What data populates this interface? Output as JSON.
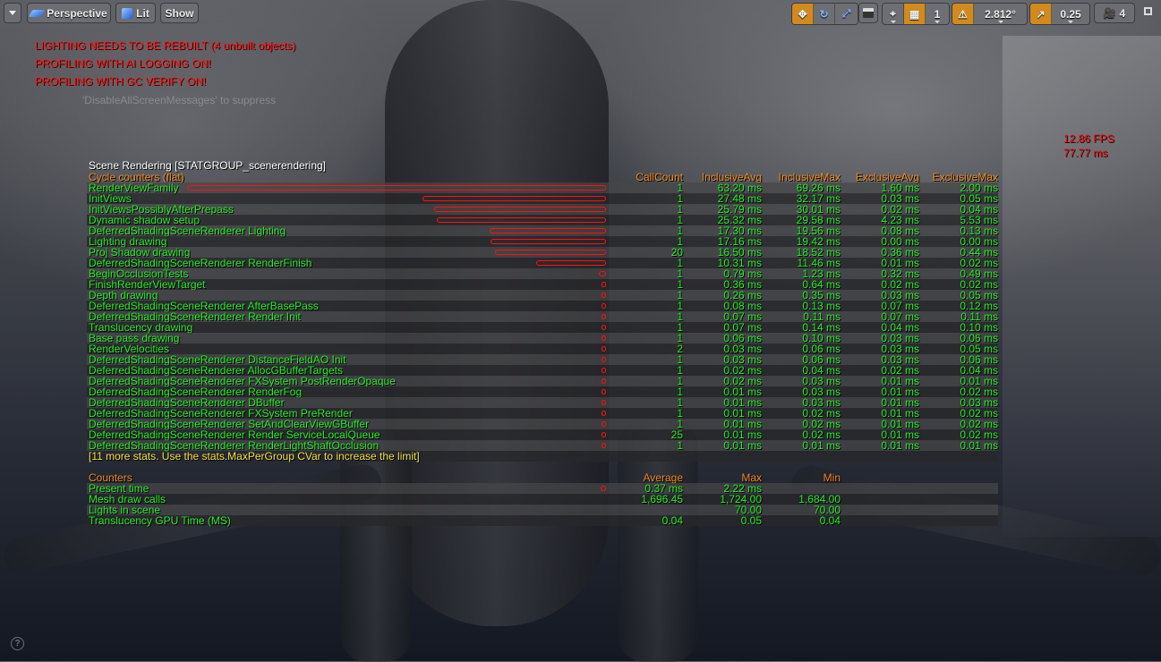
{
  "toolbar": {
    "left": {
      "options_menu_icon": "chevron-down-icon",
      "perspective_label": "Perspective",
      "lit_label": "Lit",
      "show_label": "Show"
    },
    "right": {
      "translate_icon": "move-arrows-icon",
      "rotate_icon": "rotate-icon",
      "scale_icon": "scale-icon",
      "world_local_icon": "cube-icon",
      "surface_snap_icon": "surface-snap-icon",
      "grid_snap_icon": "grid-icon",
      "grid_snap_value": "1",
      "rotation_snap_icon": "angle-icon",
      "rotation_snap_value": "2.812°",
      "scale_snap_icon": "scale-arrow-icon",
      "scale_snap_value": "0.25",
      "camera_speed_icon": "camera-speed-icon",
      "camera_speed_value": "4",
      "maximize_icon": "restore-icon"
    }
  },
  "messages": [
    "LIGHTING NEEDS TO BE REBUILT (4 unbuilt objects)",
    "PROFILING WITH AI LOGGING ON!",
    "PROFILING WITH GC VERIFY ON!"
  ],
  "suppress_hint": "'DisableAllScreenMessages' to suppress",
  "fps": {
    "fps_text": "12.86 FPS",
    "ms_text": "77.77 ms"
  },
  "stats": {
    "group_title": "Scene Rendering [STATGROUP_scenerendering]",
    "cycle_header": {
      "label": "Cycle counters (flat)",
      "call_count": "CallCount",
      "inclusive_avg": "InclusiveAvg",
      "inclusive_max": "InclusiveMax",
      "exclusive_avg": "ExclusiveAvg",
      "exclusive_max": "ExclusiveMax"
    },
    "cycle_rows": [
      {
        "name": "RenderViewFamily",
        "count": "1",
        "iavg": "63.20 ms",
        "imax": "69.26 ms",
        "eavg": "1.60 ms",
        "emax": "2.00 ms",
        "bar": 63.2
      },
      {
        "name": "InitViews",
        "count": "1",
        "iavg": "27.48 ms",
        "imax": "32.17 ms",
        "eavg": "0.03 ms",
        "emax": "0.05 ms",
        "bar": 27.48
      },
      {
        "name": "InitViewsPossiblyAfterPrepass",
        "count": "1",
        "iavg": "25.79 ms",
        "imax": "30.01 ms",
        "eavg": "0.02 ms",
        "emax": "0.04 ms",
        "bar": 25.79
      },
      {
        "name": "Dynamic shadow setup",
        "count": "1",
        "iavg": "25.32 ms",
        "imax": "29.58 ms",
        "eavg": "4.23 ms",
        "emax": "5.53 ms",
        "bar": 25.32
      },
      {
        "name": "DeferredShadingSceneRenderer Lighting",
        "count": "1",
        "iavg": "17.30 ms",
        "imax": "19.56 ms",
        "eavg": "0.08 ms",
        "emax": "0.13 ms",
        "bar": 17.3
      },
      {
        "name": "Lighting drawing",
        "count": "1",
        "iavg": "17.16 ms",
        "imax": "19.42 ms",
        "eavg": "0.00 ms",
        "emax": "0.00 ms",
        "bar": 17.16
      },
      {
        "name": "Proj Shadow drawing",
        "count": "20",
        "iavg": "16.50 ms",
        "imax": "18.52 ms",
        "eavg": "0.36 ms",
        "emax": "0.44 ms",
        "bar": 16.5
      },
      {
        "name": "DeferredShadingSceneRenderer RenderFinish",
        "count": "1",
        "iavg": "10.31 ms",
        "imax": "11.46 ms",
        "eavg": "0.01 ms",
        "emax": "0.02 ms",
        "bar": 10.31
      },
      {
        "name": "BeginOcclusionTests",
        "count": "1",
        "iavg": "0.79 ms",
        "imax": "1.23 ms",
        "eavg": "0.32 ms",
        "emax": "0.49 ms",
        "bar": 0.79
      },
      {
        "name": "FinishRenderViewTarget",
        "count": "1",
        "iavg": "0.36 ms",
        "imax": "0.64 ms",
        "eavg": "0.02 ms",
        "emax": "0.02 ms",
        "bar": 0.36
      },
      {
        "name": "Depth drawing",
        "count": "1",
        "iavg": "0.26 ms",
        "imax": "0.35 ms",
        "eavg": "0.03 ms",
        "emax": "0.05 ms",
        "bar": 0.26
      },
      {
        "name": "DeferredShadingSceneRenderer AfterBasePass",
        "count": "1",
        "iavg": "0.08 ms",
        "imax": "0.13 ms",
        "eavg": "0.07 ms",
        "emax": "0.12 ms",
        "bar": 0.08
      },
      {
        "name": "DeferredShadingSceneRenderer Render Init",
        "count": "1",
        "iavg": "0.07 ms",
        "imax": "0.11 ms",
        "eavg": "0.07 ms",
        "emax": "0.11 ms",
        "bar": 0.07
      },
      {
        "name": "Translucency drawing",
        "count": "1",
        "iavg": "0.07 ms",
        "imax": "0.14 ms",
        "eavg": "0.04 ms",
        "emax": "0.10 ms",
        "bar": 0.07
      },
      {
        "name": "Base pass drawing",
        "count": "1",
        "iavg": "0.06 ms",
        "imax": "0.10 ms",
        "eavg": "0.03 ms",
        "emax": "0.06 ms",
        "bar": 0.06
      },
      {
        "name": "RenderVelocities",
        "count": "2",
        "iavg": "0.03 ms",
        "imax": "0.06 ms",
        "eavg": "0.03 ms",
        "emax": "0.05 ms",
        "bar": 0.03
      },
      {
        "name": "DeferredShadingSceneRenderer DistanceFieldAO Init",
        "count": "1",
        "iavg": "0.03 ms",
        "imax": "0.06 ms",
        "eavg": "0.03 ms",
        "emax": "0.06 ms",
        "bar": 0.03
      },
      {
        "name": "DeferredShadingSceneRenderer AllocGBufferTargets",
        "count": "1",
        "iavg": "0.02 ms",
        "imax": "0.04 ms",
        "eavg": "0.02 ms",
        "emax": "0.04 ms",
        "bar": 0.02
      },
      {
        "name": "DeferredShadingSceneRenderer FXSystem PostRenderOpaque",
        "count": "1",
        "iavg": "0.02 ms",
        "imax": "0.03 ms",
        "eavg": "0.01 ms",
        "emax": "0.01 ms",
        "bar": 0.02
      },
      {
        "name": "DeferredShadingSceneRenderer RenderFog",
        "count": "1",
        "iavg": "0.01 ms",
        "imax": "0.03 ms",
        "eavg": "0.01 ms",
        "emax": "0.02 ms",
        "bar": 0.01
      },
      {
        "name": "DeferredShadingSceneRenderer DBuffer",
        "count": "1",
        "iavg": "0.01 ms",
        "imax": "0.03 ms",
        "eavg": "0.01 ms",
        "emax": "0.03 ms",
        "bar": 0.01
      },
      {
        "name": "DeferredShadingSceneRenderer FXSystem PreRender",
        "count": "1",
        "iavg": "0.01 ms",
        "imax": "0.02 ms",
        "eavg": "0.01 ms",
        "emax": "0.02 ms",
        "bar": 0.01
      },
      {
        "name": "DeferredShadingSceneRenderer SetAndClearViewGBuffer",
        "count": "1",
        "iavg": "0.01 ms",
        "imax": "0.02 ms",
        "eavg": "0.01 ms",
        "emax": "0.02 ms",
        "bar": 0.01
      },
      {
        "name": "DeferredShadingSceneRenderer Render ServiceLocalQueue",
        "count": "25",
        "iavg": "0.01 ms",
        "imax": "0.02 ms",
        "eavg": "0.01 ms",
        "emax": "0.02 ms",
        "bar": 0.01
      },
      {
        "name": "DeferredShadingSceneRenderer RenderLightShaftOcclusion",
        "count": "1",
        "iavg": "0.01 ms",
        "imax": "0.01 ms",
        "eavg": "0.01 ms",
        "emax": "0.01 ms",
        "bar": 0.01
      }
    ],
    "more_stats_text": "[11 more stats. Use the stats.MaxPerGroup CVar to increase the limit]",
    "counters_header": {
      "label": "Counters",
      "average": "Average",
      "max": "Max",
      "min": "Min"
    },
    "counter_rows": [
      {
        "name": "Present time",
        "avg": "0.37 ms",
        "max": "2.22 ms",
        "min": "",
        "bar": 0.37
      },
      {
        "name": "Mesh draw calls",
        "avg": "1,696.45",
        "max": "1,724.00",
        "min": "1,684.00",
        "bar": null
      },
      {
        "name": "Lights in scene",
        "avg": "",
        "max": "70.00",
        "min": "70.00",
        "bar": null
      },
      {
        "name": "Translucency GPU Time (MS)",
        "avg": "0.04",
        "max": "0.05",
        "min": "0.04",
        "bar": null
      }
    ]
  },
  "help_icon": "question-circle-icon",
  "colors": {
    "accent_orange": "#d08a1e",
    "stat_green": "#22ee22",
    "header_orange": "#f08a1a",
    "warning_red": "#ff1a1a",
    "bar_red": "#ff1010",
    "more_stats_yellow": "#f0e040"
  }
}
